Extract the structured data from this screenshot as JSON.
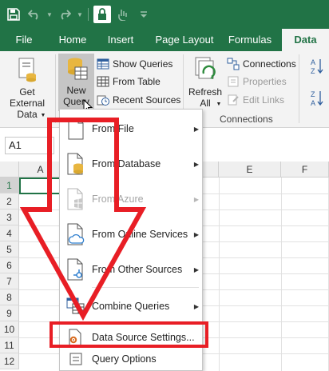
{
  "quick_access": {
    "save_icon": "save-icon",
    "undo_icon": "undo-icon",
    "redo_icon": "redo-icon",
    "lock_icon": "lock-icon",
    "touch_icon": "touch-mode-icon",
    "customize_icon": "customize-icon"
  },
  "tabs": [
    "File",
    "Home",
    "Insert",
    "Page Layout",
    "Formulas",
    "Data"
  ],
  "active_tab": "Data",
  "ribbon": {
    "get_external_line1": "Get External",
    "get_external_line2": "Data",
    "new_query_line1": "New",
    "new_query_line2": "Query",
    "show_queries": "Show Queries",
    "from_table": "From Table",
    "recent_sources": "Recent Sources",
    "refresh_line1": "Refresh",
    "refresh_line2": "All",
    "connections": "Connections",
    "properties": "Properties",
    "edit_links": "Edit Links",
    "connections_group": "Connections"
  },
  "name_box": "A1",
  "columns": [
    "A",
    "E",
    "F"
  ],
  "rows": [
    "1",
    "2",
    "3",
    "4",
    "5",
    "6",
    "7",
    "8",
    "9",
    "10",
    "11",
    "12"
  ],
  "menu": {
    "items": [
      {
        "label": "From File"
      },
      {
        "label": "From Database"
      },
      {
        "label": "From Azure"
      },
      {
        "label": "From Online Services"
      },
      {
        "label": "From Other Sources"
      },
      {
        "label": "Combine Queries"
      },
      {
        "label": "Data Source Settings..."
      },
      {
        "label": "Query Options"
      }
    ]
  },
  "colors": {
    "excel_green": "#217346",
    "annotation_red": "#e81e25"
  }
}
